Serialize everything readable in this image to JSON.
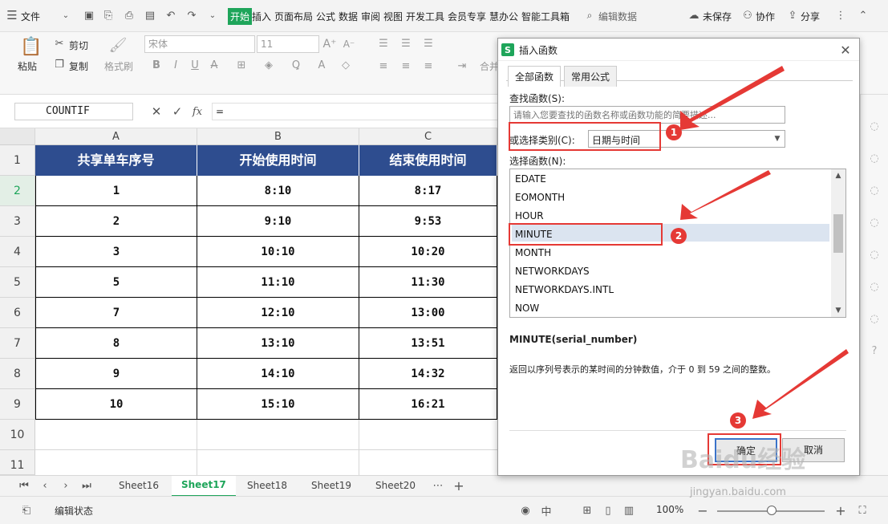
{
  "toolbar": {
    "file": "文件",
    "tabs": [
      "开始",
      "插入",
      "页面布局",
      "公式",
      "数据",
      "审阅",
      "视图",
      "开发工具",
      "会员专享",
      "慧办公",
      "智能工具箱"
    ],
    "search": "编辑数据",
    "unsaved": "未保存",
    "collab": "协作",
    "share": "分享"
  },
  "ribbon": {
    "paste": "粘贴",
    "cut": "剪切",
    "copy": "复制",
    "format_painter": "格式刷",
    "font": "宋体",
    "size": "11",
    "merge": "合并"
  },
  "formula_bar": {
    "name_box": "COUNTIF",
    "fx": "fx",
    "value": "="
  },
  "grid": {
    "columns": [
      "A",
      "B",
      "C"
    ],
    "rows": [
      "1",
      "2",
      "3",
      "4",
      "5",
      "6",
      "7",
      "8",
      "9",
      "10",
      "11"
    ],
    "header": [
      "共享单车序号",
      "开始使用时间",
      "结束使用时间"
    ],
    "data": [
      [
        "1",
        "8:10",
        "8:17"
      ],
      [
        "2",
        "9:10",
        "9:53"
      ],
      [
        "3",
        "10:10",
        "10:20"
      ],
      [
        "5",
        "11:10",
        "11:30"
      ],
      [
        "7",
        "12:10",
        "13:00"
      ],
      [
        "8",
        "13:10",
        "13:51"
      ],
      [
        "9",
        "14:10",
        "14:32"
      ],
      [
        "10",
        "15:10",
        "16:21"
      ]
    ]
  },
  "sheets": [
    "Sheet16",
    "Sheet17",
    "Sheet18",
    "Sheet19",
    "Sheet20"
  ],
  "status": {
    "mode": "编辑状态",
    "zoom": "100%"
  },
  "dialog": {
    "title": "插入函数",
    "tabs": [
      "全部函数",
      "常用公式"
    ],
    "search_label": "查找函数(S):",
    "search_placeholder": "请输入您要查找的函数名称或函数功能的简要描述...",
    "category_label": "或选择类别(C):",
    "category_value": "日期与时间",
    "select_label": "选择函数(N):",
    "functions": [
      "EDATE",
      "EOMONTH",
      "HOUR",
      "MINUTE",
      "MONTH",
      "NETWORKDAYS",
      "NETWORKDAYS.INTL",
      "NOW"
    ],
    "selected": "MINUTE",
    "signature": "MINUTE(serial_number)",
    "description": "返回以序列号表示的某时间的分钟数值，介于 0 到 59 之间的整数。",
    "ok": "确定",
    "cancel": "取消"
  },
  "annotations": {
    "badges": [
      "1",
      "2",
      "3"
    ],
    "watermark": "Baidu经验",
    "watermark_url": "jingyan.baidu.com"
  },
  "colors": {
    "header_bg": "#2e4d8f",
    "accent_red": "#e53935",
    "active_tab": "#1ea55a"
  }
}
